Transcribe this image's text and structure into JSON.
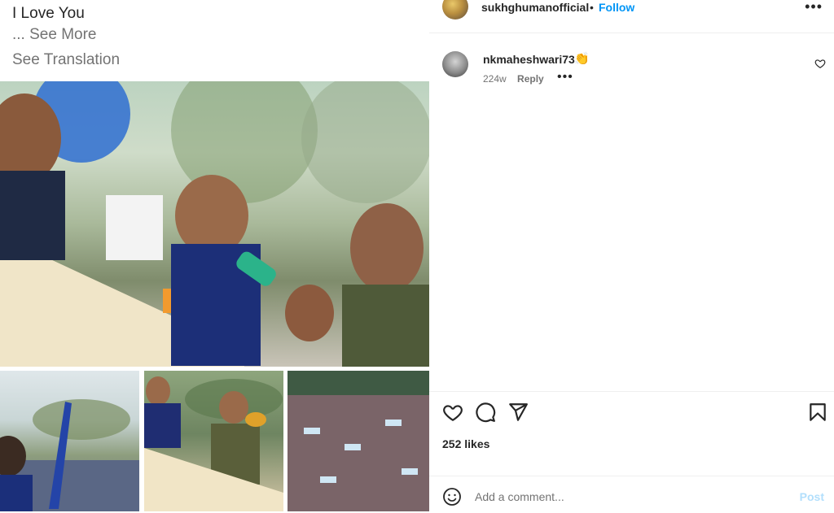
{
  "caption": {
    "line": "I Love You",
    "see_more": "... See More",
    "see_translation": "See Translation"
  },
  "media": {
    "main_photo_icon": "photo-rally-image",
    "thumbnails": [
      "rally-crowd-thumbnail",
      "stage-leaders-thumbnail",
      "crowd-aerial-thumbnail"
    ]
  },
  "header": {
    "username": "sukhghumanofficial",
    "separator": "•",
    "follow_label": "Follow",
    "more_icon": "more-horizontal-icon"
  },
  "comments": [
    {
      "username": "nkmaheshwari73",
      "emoji": "👏",
      "age": "224w",
      "reply_label": "Reply",
      "more": "•••"
    }
  ],
  "actions": {
    "like_icon": "heart-icon",
    "comment_icon": "comment-icon",
    "share_icon": "share-icon",
    "save_icon": "bookmark-icon"
  },
  "likes": "252 likes",
  "add_comment": {
    "placeholder": "Add a comment...",
    "post_label": "Post",
    "emoji_icon": "emoji-icon"
  },
  "colors": {
    "link_blue": "#0095f6",
    "post_disabled": "#b2dffc",
    "text": "#262626",
    "muted": "#737373"
  }
}
